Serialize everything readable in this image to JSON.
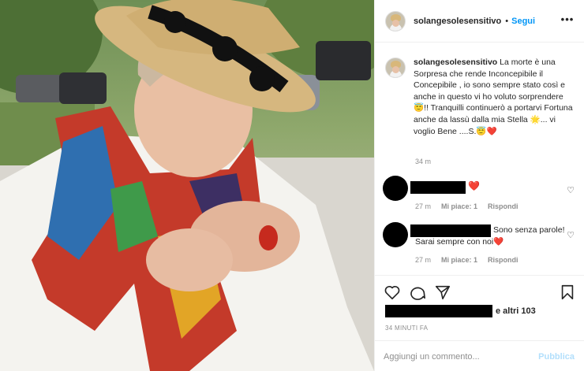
{
  "post": {
    "username": "solangesolesensitivo",
    "follow_label": "Segui",
    "separator": "•",
    "more_label": "•••",
    "caption": "La morte è una Sorpresa che rende Inconcepibile il Concepibile , io sono sempre stato così e anche in questo vi ho voluto sorprendere 😇!! Tranquilli continuerò a portarvi Fortuna anche da lassù dalla mia Stella 🌟... vi voglio Bene ....S.😇❤️",
    "caption_time": "34 m"
  },
  "comments": [
    {
      "text": "",
      "trailing_emoji": "❤️",
      "time": "27 m",
      "likes": "Mi piace: 1",
      "reply": "Rispondi"
    },
    {
      "text": "Sono senza parole! Sarai sempre con noi❤️",
      "trailing_emoji": "",
      "time": "27 m",
      "likes": "Mi piace: 1",
      "reply": "Rispondi"
    }
  ],
  "icons": {
    "like": "heart-outline-icon",
    "comment": "comment-bubble-icon",
    "share": "paper-plane-icon",
    "save": "bookmark-icon",
    "comment_like": "small-heart-icon",
    "more": "ellipsis-icon"
  },
  "likes_text": "e altri 103",
  "post_time": "34 MINUTI FA",
  "add_comment": {
    "placeholder": "Aggiungi un commento...",
    "publish_label": "Pubblica"
  },
  "colors": {
    "accent": "#0095f6",
    "publish_disabled": "#b2dffc",
    "muted": "#8e8e8e",
    "heart": "#e0245e"
  }
}
